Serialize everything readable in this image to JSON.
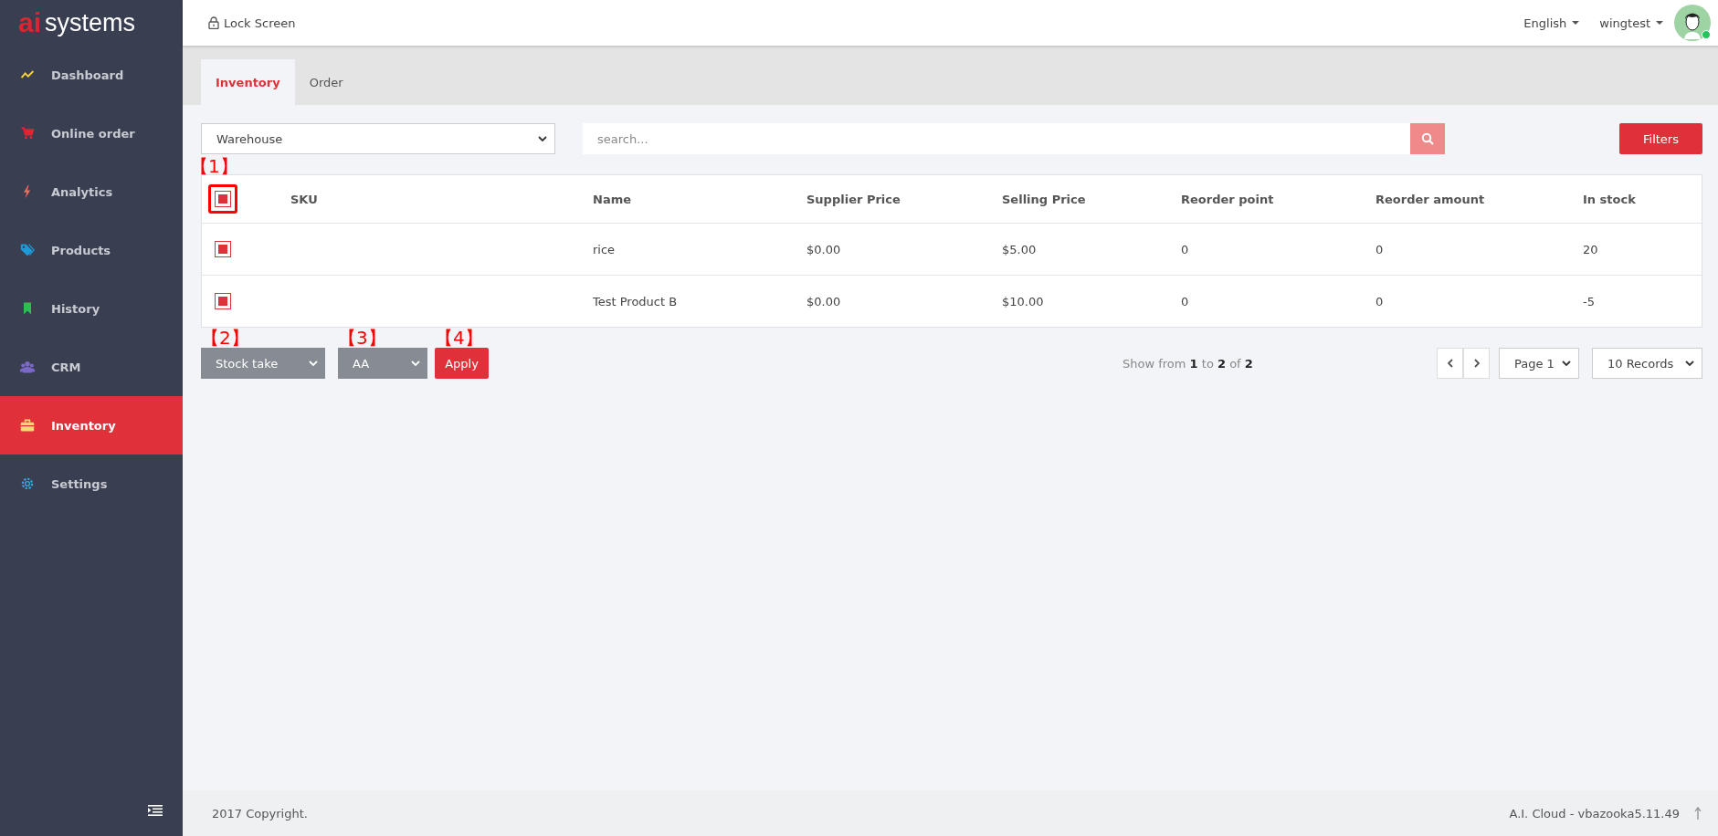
{
  "logo": {
    "mark": "ai",
    "name": "systems"
  },
  "sidebar": {
    "items": [
      {
        "label": "Dashboard",
        "kind": "chart",
        "color": "#f5d33b",
        "selected": false
      },
      {
        "label": "Online order",
        "kind": "cart",
        "color": "#e5262f",
        "selected": false
      },
      {
        "label": "Analytics",
        "kind": "bolt",
        "color": "#ee6b5e",
        "selected": false
      },
      {
        "label": "Products",
        "kind": "tag",
        "color": "#1e9ad6",
        "selected": false
      },
      {
        "label": "History",
        "kind": "bookmark",
        "color": "#2fbf4d",
        "selected": false
      },
      {
        "label": "CRM",
        "kind": "users",
        "color": "#7b68c9",
        "selected": false
      },
      {
        "label": "Inventory",
        "kind": "briefcase",
        "color": "#f8d774",
        "selected": true
      },
      {
        "label": "Settings",
        "kind": "gear",
        "color": "#2fa9de",
        "selected": false
      }
    ]
  },
  "header": {
    "lock": "Lock Screen",
    "language": "English",
    "user": "wingtest",
    "online": true
  },
  "tabs": [
    {
      "label": "Inventory",
      "selected": true
    },
    {
      "label": "Order",
      "selected": false
    }
  ],
  "warehouse": {
    "value": "Warehouse"
  },
  "search": {
    "placeholder": "search..."
  },
  "filters_button": "Filters",
  "table": {
    "columns": [
      "SKU",
      "Name",
      "Supplier Price",
      "Selling Price",
      "Reorder point",
      "Reorder amount",
      "In stock"
    ],
    "header_checked": true,
    "rows": [
      {
        "checked": true,
        "cells": [
          "",
          "rice",
          "$0.00",
          "$5.00",
          "0",
          "0",
          "20"
        ]
      },
      {
        "checked": true,
        "cells": [
          "",
          "Test Product B",
          "$0.00",
          "$10.00",
          "0",
          "0",
          "-5"
        ]
      }
    ]
  },
  "annotations": [
    "【1】",
    "【2】",
    "【3】",
    "【4】"
  ],
  "actions": {
    "action": "Stock take",
    "target": "AA",
    "apply": "Apply"
  },
  "summary": "Show from **1** to **2** of **2**",
  "pagination": {
    "page": "Page 1",
    "records": "10 Records"
  },
  "footer": {
    "copyright": "2017 Copyright.",
    "version": "A.I. Cloud - vbazooka5.11.49"
  }
}
